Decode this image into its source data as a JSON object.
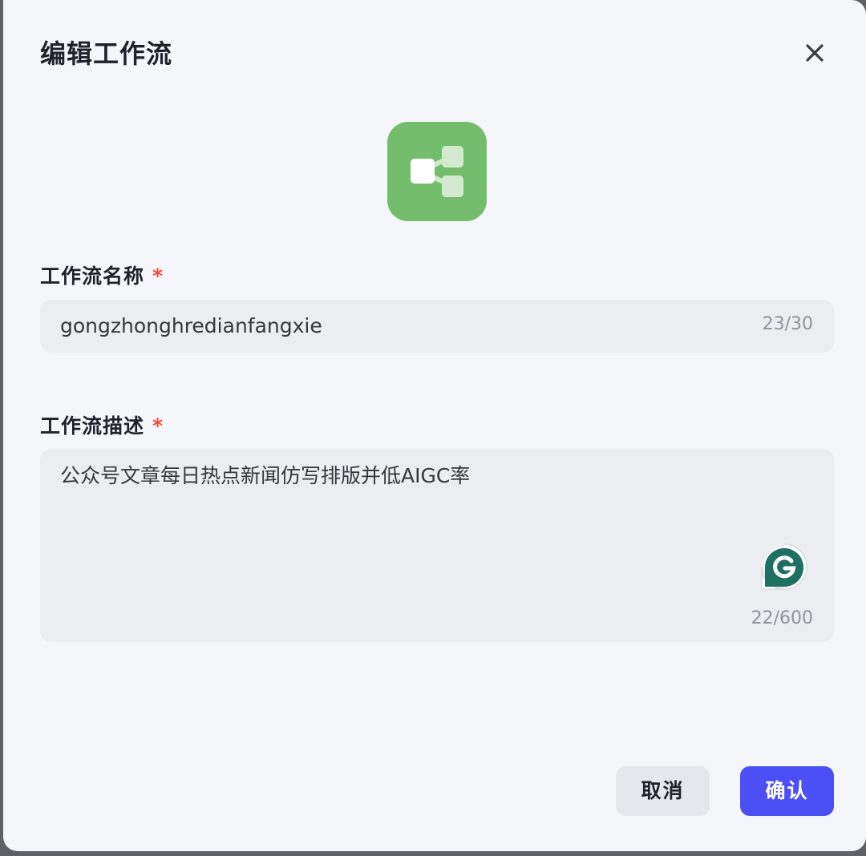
{
  "dialog": {
    "title": "编辑工作流",
    "close_icon": "close-icon"
  },
  "workflow_icon": {
    "icon": "workflow-branch-icon",
    "background_color": "#74bd6c"
  },
  "name_field": {
    "label": "工作流名称",
    "required_mark": "*",
    "value": "gongzhonghredianfangxie",
    "counter": "23/30"
  },
  "description_field": {
    "label": "工作流描述",
    "required_mark": "*",
    "value": "公众号文章每日热点新闻仿写排版并低AIGC率",
    "counter": "22/600",
    "assistant_icon": "grammarly-icon"
  },
  "footer": {
    "cancel_label": "取消",
    "confirm_label": "确认"
  },
  "colors": {
    "accent": "#4b4ff5",
    "required": "#f24a36",
    "field_bg": "#ecedf1",
    "dialog_bg": "#f5f6fa"
  }
}
